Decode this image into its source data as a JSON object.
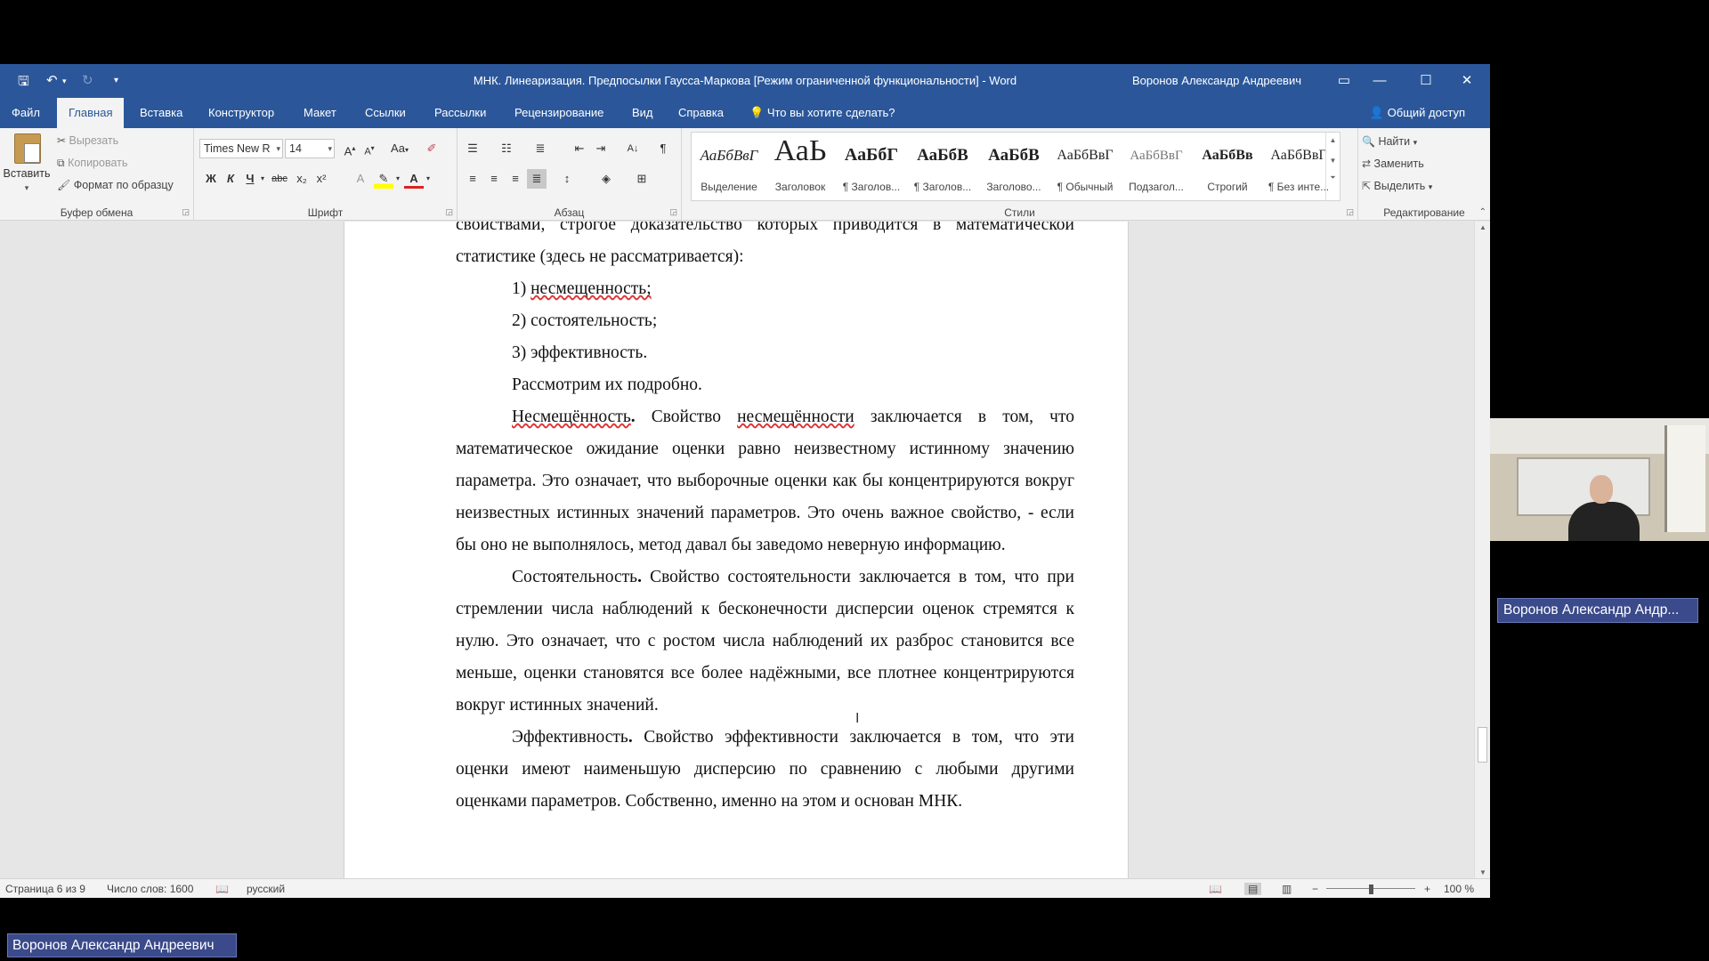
{
  "window": {
    "title": "МНК. Линеаризация. Предпосылки Гаусса-Маркова [Режим ограниченной функциональности]  -  Word",
    "user": "Воронов Александр Андреевич"
  },
  "tabs": [
    "Файл",
    "Главная",
    "Вставка",
    "Конструктор",
    "Макет",
    "Ссылки",
    "Рассылки",
    "Рецензирование",
    "Вид",
    "Справка"
  ],
  "tell_me": "Что вы хотите сделать?",
  "share": "Общий доступ",
  "clipboard": {
    "paste": "Вставить",
    "cut": "Вырезать",
    "copy": "Копировать",
    "format_painter": "Формат по образцу",
    "label": "Буфер обмена"
  },
  "font": {
    "name": "Times New R",
    "size": "14",
    "label": "Шрифт",
    "case_label": "Aa",
    "bold": "Ж",
    "italic": "К",
    "underline": "Ч",
    "strike": "abc",
    "subscript": "x₂",
    "superscript": "x²"
  },
  "paragraph": {
    "label": "Абзац"
  },
  "styles": {
    "label": "Стили",
    "items": [
      {
        "sample": "АаБбВвГ",
        "name": "Выделение"
      },
      {
        "sample": "АаЬ",
        "name": "Заголовок"
      },
      {
        "sample": "АаБбГ",
        "name": "¶ Заголов..."
      },
      {
        "sample": "АаБбВ",
        "name": "¶ Заголов..."
      },
      {
        "sample": "АаБбВ",
        "name": "Заголово..."
      },
      {
        "sample": "АаБбВвГ",
        "name": "¶ Обычный"
      },
      {
        "sample": "АаБбВвГ",
        "name": "Подзагол..."
      },
      {
        "sample": "АаБбВв",
        "name": "Строгий"
      },
      {
        "sample": "АаБбВвГ",
        "name": "¶ Без инте..."
      }
    ]
  },
  "editing": {
    "label": "Редактирование",
    "find": "Найти",
    "replace": "Заменить",
    "select": "Выделить"
  },
  "document": {
    "p0": "свойствами, строгое доказательство которых приводится в математической статистике (здесь не рассматривается):",
    "list": [
      {
        "num": "1)",
        "text": "несмещенность;"
      },
      {
        "num": "2)",
        "text": "состоятельность;"
      },
      {
        "num": "3)",
        "text": "эффективность."
      }
    ],
    "p1": "Рассмотрим их подробно.",
    "unbiased_title": "Несмещённость",
    "unbiased_a": " Свойство ",
    "unbiased_word": "несмещённости",
    "unbiased_b": " заключается в том, что математическое ожидание оценки равно неизвестному истинному значению параметра. Это означает, что выборочные оценки как бы концентрируются вокруг неизвестных истинных значений параметров. Это очень важное свойство, - если бы оно не выполнялось, метод давал бы заведомо неверную информацию.",
    "consistent_title": "Состоятельность",
    "consistent_text": " Свойство состоятельности заключается в том, что при стремлении числа наблюдений к бесконечности дисперсии оценок стремятся к нулю. Это означает, что с ростом числа наблюдений их разброс становится все меньше, оценки становятся все более надёжными, все плотнее концентрируются вокруг истинных значений.",
    "efficient_title": "Эффективность",
    "efficient_text": " Свойство эффективности заключается в том, что эти оценки имеют наименьшую дисперсию по сравнению с любыми другими оценками параметров. Собственно, именно на этом и основан МНК."
  },
  "status": {
    "page": "Страница 6 из 9",
    "words": "Число слов: 1600",
    "language": "русский",
    "zoom": "100 %"
  },
  "video": {
    "right_label": "Воронов Александр Андр...",
    "bottom_label": "Воронов Александр Андреевич"
  },
  "colors": {
    "titlebar": "#2b579a",
    "ribbon": "#f3f3f3",
    "name_tag": "#3a4a8a"
  }
}
